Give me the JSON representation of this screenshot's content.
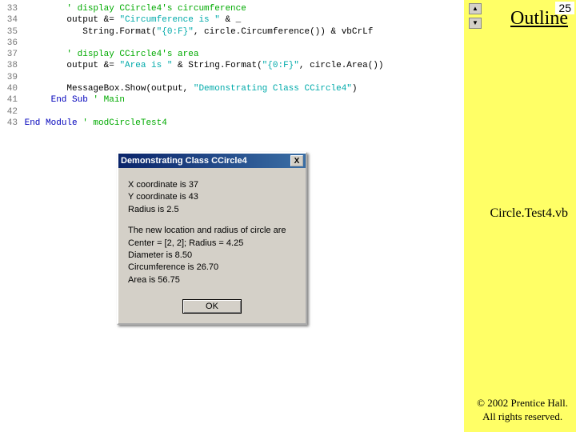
{
  "page_number": "25",
  "outline_title": "Outline",
  "filename": "Circle.Test4.vb",
  "copyright_line1": "© 2002 Prentice Hall.",
  "copyright_line2": "All rights reserved.",
  "arrow_up": "▲",
  "arrow_down": "▼",
  "code": {
    "l33_ln": "33",
    "l33_cmt": "' display CCircle4's circumference",
    "l34_ln": "34",
    "l34_a": "output &= ",
    "l34_str": "\"Circumference is \"",
    "l34_b": " & _",
    "l35_ln": "35",
    "l35_a": "String.Format(",
    "l35_str": "\"{0:F}\"",
    "l35_b": ", circle.Circumference()) & vbCrLf",
    "l36_ln": "36",
    "l37_ln": "37",
    "l37_cmt": "' display CCircle4's area",
    "l38_ln": "38",
    "l38_a": "output &= ",
    "l38_str1": "\"Area is \"",
    "l38_b": " & String.Format(",
    "l38_str2": "\"{0:F}\"",
    "l38_c": ", circle.Area())",
    "l39_ln": "39",
    "l40_ln": "40",
    "l40_a": "MessageBox.Show(output, ",
    "l40_str": "\"Demonstrating Class CCircle4\"",
    "l40_b": ")",
    "l41_ln": "41",
    "l41_kw": "End Sub ",
    "l41_cmt": "' Main",
    "l42_ln": "42",
    "l43_ln": "43",
    "l43_kw": "End Module ",
    "l43_cmt": "' modCircleTest4"
  },
  "dialog": {
    "title": "Demonstrating Class CCircle4",
    "close": "X",
    "body1": "X coordinate is 37\nY coordinate is 43\nRadius is 2.5",
    "body2": "The new location and radius of circle are\nCenter = [2, 2]; Radius = 4.25\nDiameter is 8.50\nCircumference is 26.70\nArea is 56.75",
    "ok": "OK"
  }
}
